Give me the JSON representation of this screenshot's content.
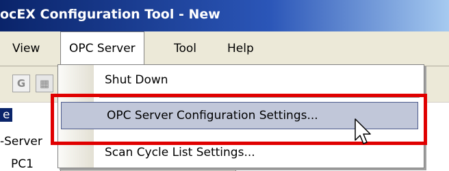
{
  "window": {
    "title": "ocEX Configuration Tool - New"
  },
  "menubar": {
    "items": [
      "View",
      "OPC Server",
      "Tool",
      "Help"
    ]
  },
  "toolbar": {
    "icons": [
      "g-icon",
      "disabled-toolbar-icon"
    ]
  },
  "tree": {
    "items": [
      "e",
      "-Server",
      "PC1"
    ]
  },
  "opc_server_menu": {
    "items": [
      {
        "label": "Shut Down"
      },
      {
        "label": "OPC Server Configuration Settings...",
        "hovered": true
      },
      {
        "label": "Scan Cycle List Settings..."
      }
    ]
  },
  "colors": {
    "title_bar": "#0a246a",
    "menu_hover": "#c1c7d9",
    "highlight_box": "#e00000"
  }
}
